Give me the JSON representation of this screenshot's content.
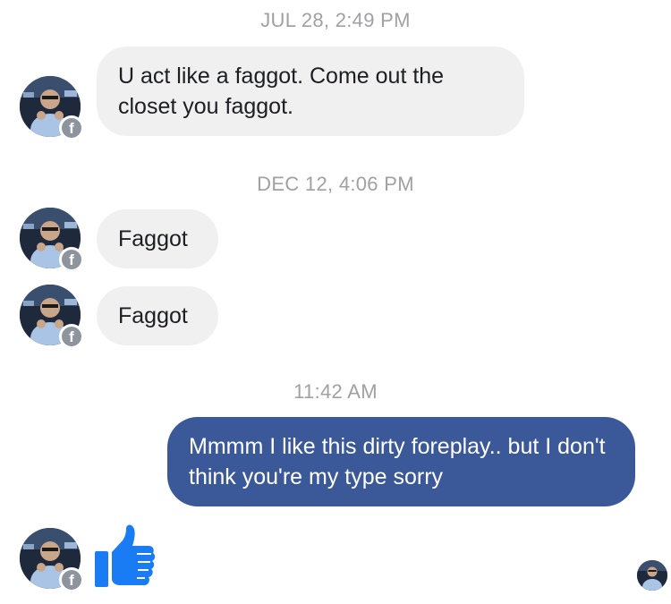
{
  "conversation": {
    "timestamps": [
      "JUL 28, 2:49 PM",
      "DEC 12, 4:06 PM",
      "11:42 AM"
    ],
    "messages": [
      {
        "text": "U act like a faggot.  Come out the closet you faggot."
      },
      {
        "text": "Faggot"
      },
      {
        "text": "Faggot"
      },
      {
        "text": "Mmmm I like this dirty foreplay.. but I don't think you're my type sorry"
      }
    ],
    "badge_letter": "f"
  },
  "colors": {
    "incoming_bubble": "#f0f0f0",
    "outgoing_bubble": "#3b5998",
    "like_icon": "#1a7cf5",
    "timestamp": "#a0a0a5"
  },
  "icons": {
    "like": "thumbs-up-icon",
    "badge": "facebook-icon"
  }
}
